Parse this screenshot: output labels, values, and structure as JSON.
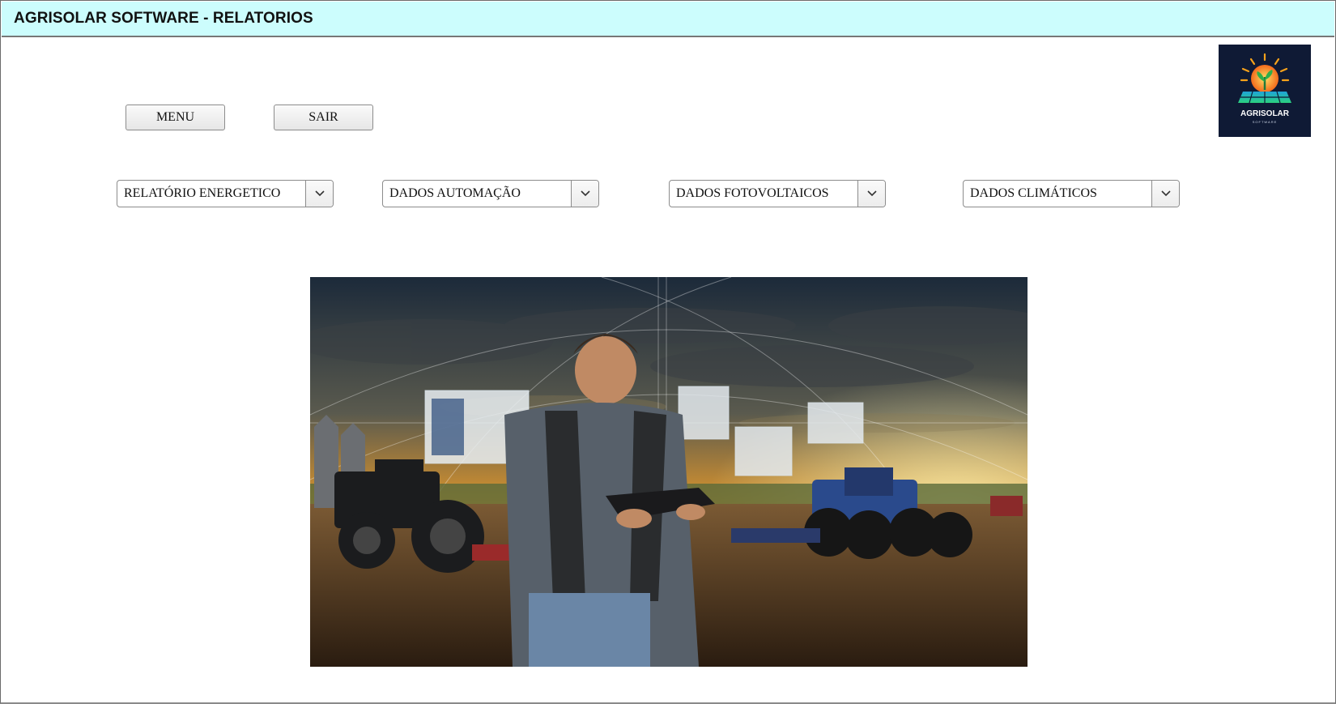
{
  "window": {
    "title": "AGRISOLAR SOFTWARE - RELATORIOS"
  },
  "buttons": {
    "menu": "MENU",
    "sair": "SAIR"
  },
  "dropdowns": [
    {
      "value": "RELATÓRIO ENERGETICO"
    },
    {
      "value": "DADOS AUTOMAÇÃO"
    },
    {
      "value": "DADOS FOTOVOLTAICOS"
    },
    {
      "value": "DADOS CLIMÁTICOS"
    }
  ],
  "logo": {
    "brand": "AGRISOLAR",
    "sub": "SOFTWARE"
  },
  "colors": {
    "titlebar_bg": "#ccfdfd",
    "logo_bg": "#0f1a35",
    "sky_orange": "#f0a828"
  },
  "icons": {
    "dropdown": "chevron-down-icon"
  }
}
